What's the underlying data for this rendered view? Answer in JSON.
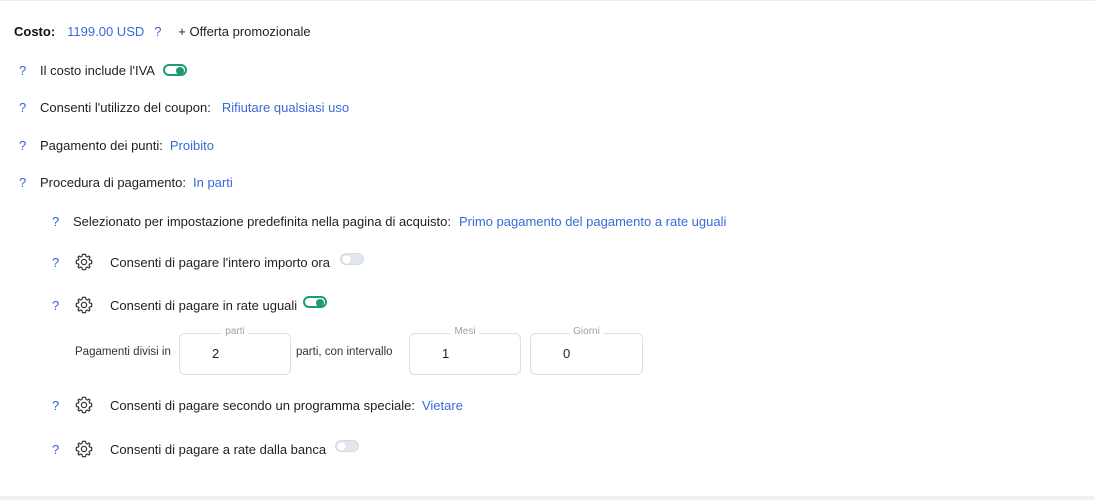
{
  "cost": {
    "label": "Costo:",
    "value": "1199.00 USD",
    "help": "?",
    "promo_button": "+ Offerta promozionale"
  },
  "vat": {
    "help": "?",
    "label": "Il costo include l'IVA",
    "enabled": true
  },
  "coupon": {
    "help": "?",
    "label": "Consenti l'utilizzo del coupon:",
    "value": "Rifiutare qualsiasi uso"
  },
  "points": {
    "help": "?",
    "label": "Pagamento dei punti:",
    "value": "Proibito"
  },
  "procedure": {
    "help": "?",
    "label": "Procedura di pagamento:",
    "value": "In parti"
  },
  "default_selection": {
    "help": "?",
    "label": "Selezionato per impostazione predefinita nella pagina di acquisto:",
    "value": "Primo pagamento del pagamento a rate uguali"
  },
  "full_amount": {
    "help": "?",
    "icon": "gear-icon",
    "label": "Consenti di pagare l'intero importo ora",
    "enabled": false
  },
  "equal_installments": {
    "help": "?",
    "icon": "gear-icon",
    "label": "Consenti di pagare in rate uguali",
    "enabled": true
  },
  "installment_config": {
    "prefix": "Pagamenti divisi in",
    "parts_label": "parti",
    "parts_value": "2",
    "middle": "parti, con intervallo",
    "months_label": "Mesi",
    "months_value": "1",
    "days_label": "Giorni",
    "days_value": "0"
  },
  "special_program": {
    "help": "?",
    "icon": "gear-icon",
    "label": "Consenti di pagare secondo un programma speciale:",
    "value": "Vietare"
  },
  "bank_installments": {
    "help": "?",
    "icon": "gear-icon",
    "label": "Consenti di pagare a rate dalla banca",
    "enabled": false
  },
  "colors": {
    "accent": "#3a6ad8",
    "toggle_on": "#1e9b6c",
    "toggle_off": "#e3e7ef"
  }
}
